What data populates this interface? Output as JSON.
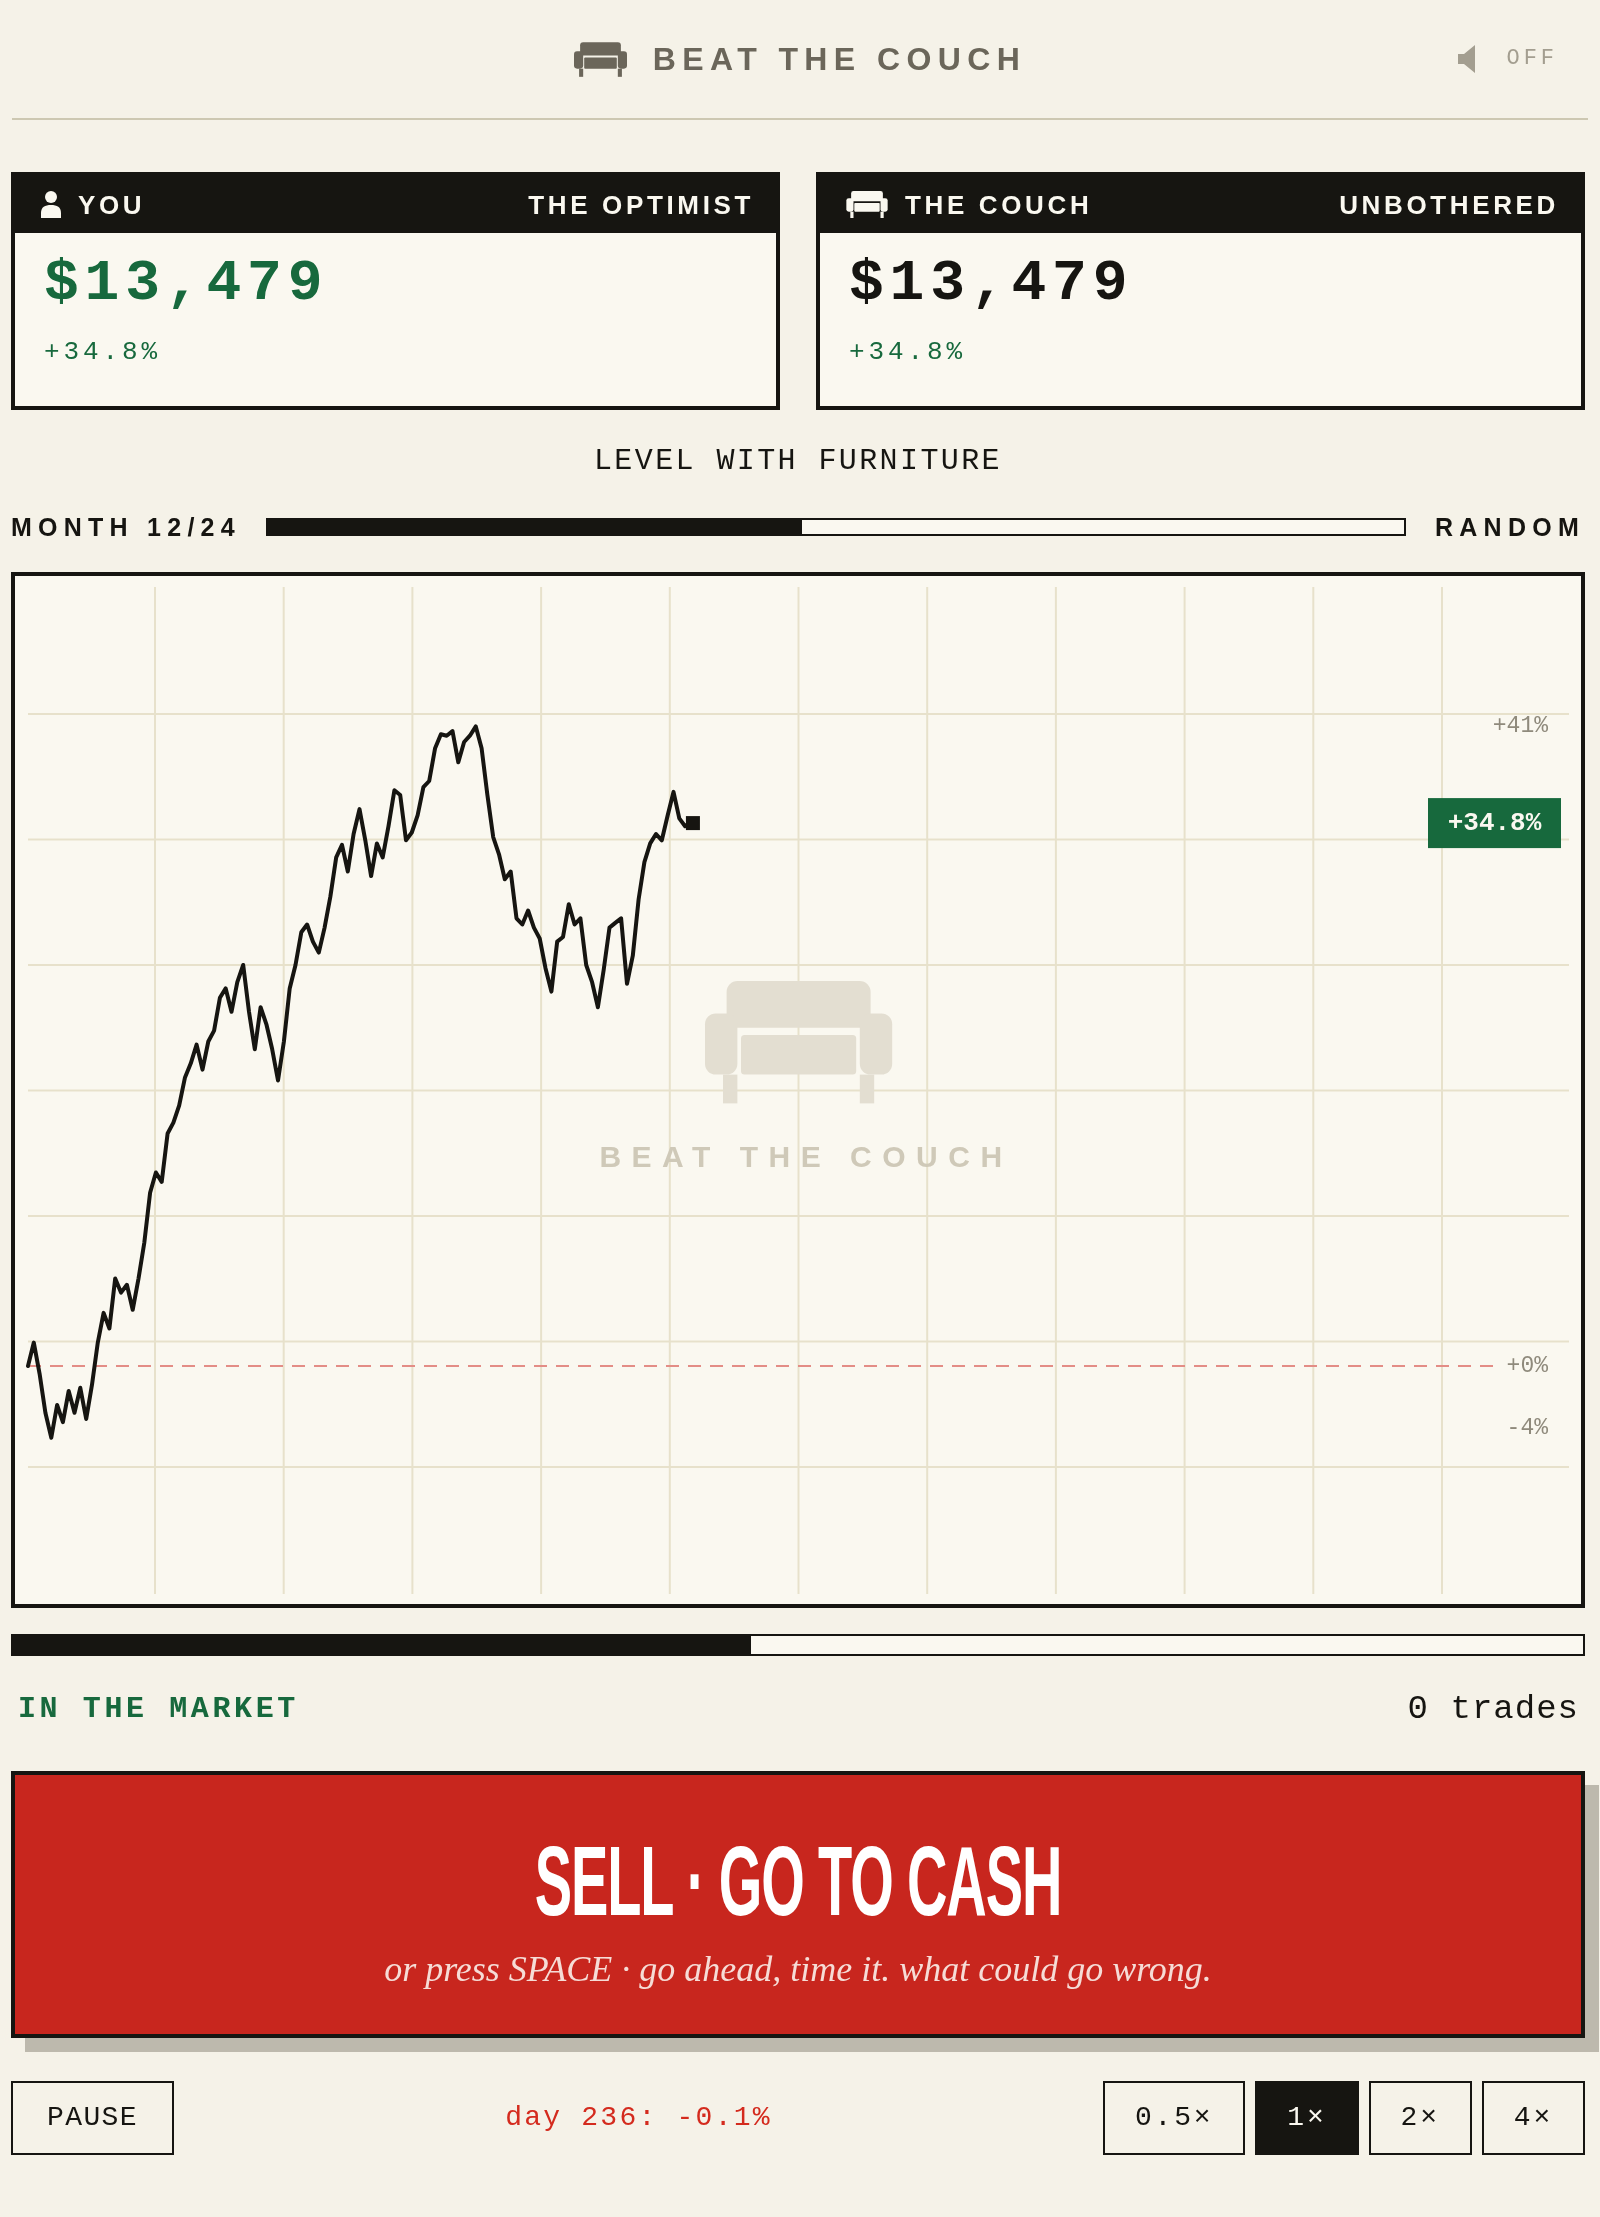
{
  "header": {
    "title": "BEAT THE COUCH",
    "sound": {
      "on": false,
      "label": "OFF"
    }
  },
  "scoreboards": [
    {
      "kind": "player",
      "name": "YOU",
      "tag": "THE OPTIMIST",
      "amount": "$13,479",
      "change": "+34.8%"
    },
    {
      "kind": "couch",
      "name": "THE COUCH",
      "tag": "UNBOTHERED",
      "amount": "$13,479",
      "change": "+34.8%"
    }
  ],
  "verdict": "LEVEL WITH FURNITURE",
  "progress": {
    "month": "MONTH 12/24",
    "level": 0.47,
    "mode": "RANDOM"
  },
  "chart": {
    "watermark": "BEAT THE COUCH",
    "chart_data": {
      "type": "line",
      "grid": true,
      "ylim": [
        -15.26,
        50.64
      ],
      "yticks": [
        {
          "value": 41,
          "label": "+41%"
        },
        {
          "value": 0,
          "label": "+0%"
        },
        {
          "value": -4,
          "label": "-4%"
        }
      ],
      "categories": [
        null,
        null,
        null,
        null,
        null,
        null,
        null,
        null,
        null,
        null,
        null,
        null,
        null,
        null,
        null,
        null,
        null,
        null,
        null,
        null,
        null,
        null,
        null,
        null,
        null,
        null,
        null,
        null,
        null,
        null,
        null,
        null,
        null,
        null,
        null,
        null,
        null,
        null,
        null,
        null,
        null,
        null,
        null,
        null,
        null,
        null,
        null,
        null,
        null,
        null,
        null,
        null,
        null,
        null,
        null,
        null,
        null,
        null,
        null,
        null,
        null,
        null,
        null,
        null,
        null,
        null,
        null,
        null,
        null,
        null,
        null,
        null,
        null,
        null,
        null,
        null,
        null,
        null,
        null,
        null,
        null,
        null,
        null,
        null,
        null,
        null,
        null,
        null,
        null,
        null,
        null,
        null,
        null,
        null,
        null,
        null,
        null,
        null,
        null,
        null,
        null,
        null,
        null,
        null,
        null,
        null,
        null,
        null,
        null,
        null,
        null,
        null,
        null,
        null,
        null,
        null,
        null,
        null,
        null,
        null,
        null,
        null,
        null,
        null,
        null,
        null,
        null,
        null,
        null,
        null,
        null,
        null,
        null,
        null,
        null,
        null,
        null,
        null,
        null,
        null,
        null,
        null,
        null,
        null,
        null,
        null,
        null,
        null,
        null,
        null,
        null,
        null,
        null,
        null,
        null,
        null,
        null,
        null,
        null,
        null,
        null,
        null,
        null,
        null,
        null,
        null,
        null,
        null,
        null,
        null,
        null,
        null,
        null,
        null,
        null,
        null,
        null,
        null,
        null,
        null,
        null,
        null,
        null,
        null,
        null,
        null,
        null,
        null,
        null,
        null,
        null,
        null,
        null,
        null,
        null,
        null,
        null,
        null,
        null,
        null,
        null,
        null,
        null,
        null,
        null,
        null,
        null,
        null,
        null,
        null,
        null,
        null,
        null,
        null,
        null,
        null,
        null,
        null,
        null,
        null,
        null,
        null,
        null,
        null,
        null,
        null,
        null,
        null,
        null,
        null,
        null,
        null,
        null,
        null,
        null,
        null,
        null,
        null,
        null,
        null,
        null,
        null,
        null,
        null,
        null,
        null,
        null,
        null,
        null,
        null,
        null,
        null,
        null,
        null,
        null,
        null,
        null,
        null,
        null,
        null,
        null,
        null,
        null,
        null,
        null,
        null
      ],
      "values": [
        0.0,
        1.5,
        -0.5,
        -3.0,
        -4.6,
        -2.5,
        -3.6,
        -1.6,
        -3.0,
        -1.4,
        -3.4,
        -1.2,
        1.5,
        3.4,
        2.4,
        5.6,
        4.7,
        5.2,
        3.6,
        5.6,
        7.9,
        11.1,
        12.4,
        11.8,
        14.9,
        15.6,
        16.7,
        18.5,
        19.4,
        20.6,
        19.0,
        20.8,
        21.5,
        23.6,
        24.2,
        22.7,
        24.6,
        25.7,
        22.7,
        20.3,
        23.0,
        21.9,
        20.3,
        18.3,
        20.8,
        24.2,
        25.7,
        27.8,
        28.3,
        27.2,
        26.5,
        28.1,
        30.1,
        32.6,
        33.4,
        31.7,
        34.1,
        35.7,
        33.7,
        31.4,
        33.5,
        32.6,
        34.6,
        36.9,
        36.6,
        33.7,
        34.2,
        35.3,
        37.1,
        37.5,
        39.6,
        40.5,
        40.4,
        40.7,
        38.7,
        40.0,
        40.4,
        41.0,
        39.6,
        36.6,
        33.9,
        32.8,
        31.2,
        31.7,
        28.7,
        28.3,
        29.2,
        28.1,
        27.4,
        25.5,
        24.0,
        27.2,
        27.5,
        29.6,
        28.3,
        28.7,
        25.7,
        24.6,
        23.0,
        25.4,
        28.1,
        28.4,
        28.7,
        24.5,
        26.3,
        29.9,
        32.3,
        33.5,
        34.1,
        33.7,
        35.3,
        36.8,
        35.1,
        34.6,
        34.8,
        null,
        null,
        null,
        null,
        null,
        null,
        null,
        null,
        null,
        null,
        null,
        null,
        null,
        null,
        null,
        null,
        null,
        null,
        null,
        null,
        null,
        null,
        null,
        null,
        null,
        null,
        null,
        null,
        null,
        null,
        null,
        null,
        null,
        null,
        null,
        null,
        null,
        null,
        null,
        null,
        null,
        null,
        null,
        null,
        null,
        null,
        null,
        null,
        null,
        null,
        null,
        null,
        null,
        null,
        null,
        null,
        null,
        null,
        null,
        null,
        null,
        null,
        null,
        null,
        null,
        null,
        null,
        null,
        null,
        null,
        null,
        null,
        null,
        null,
        null,
        null,
        null,
        null,
        null,
        null,
        null,
        null,
        null,
        null,
        null,
        null,
        null,
        null,
        null,
        null,
        null,
        null,
        null,
        null,
        null,
        null,
        null,
        null,
        null,
        null,
        null,
        null,
        null,
        null,
        null,
        null,
        null,
        null,
        null,
        null,
        null,
        null,
        null,
        null,
        null,
        null,
        null,
        null,
        null,
        null,
        null,
        null,
        null,
        null,
        null,
        null,
        null,
        null,
        null,
        null,
        null,
        null,
        null,
        null,
        null,
        null,
        null,
        null,
        null,
        null,
        null,
        null,
        null,
        null,
        null,
        null,
        null,
        null,
        null,
        null,
        null
      ],
      "ref_lines": [
        {
          "axis": "y",
          "value": 0
        }
      ],
      "annotations": [
        "+34.8%"
      ]
    }
  },
  "timeline": {
    "level": 0.47
  },
  "status": {
    "position": "IN THE MARKET",
    "trades": "0 trades"
  },
  "sell_button": {
    "label": "SELL · GO TO CASH",
    "hint": "or press SPACE · go ahead, time it. what could go wrong."
  },
  "controls": {
    "pause": "PAUSE",
    "last_day": "day 236: -0.1%",
    "speeds": [
      {
        "label": "0.5×",
        "selected": false
      },
      {
        "label": "1×",
        "selected": true
      },
      {
        "label": "2×",
        "selected": false
      },
      {
        "label": "4×",
        "selected": false
      }
    ]
  }
}
